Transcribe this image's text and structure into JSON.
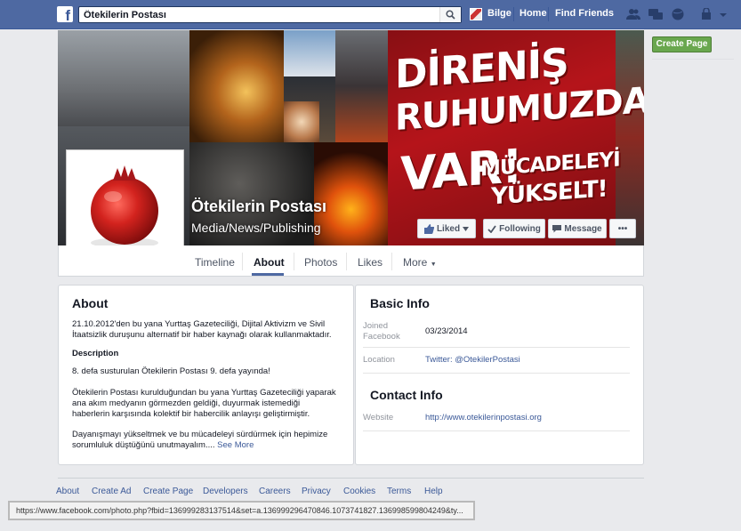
{
  "topbar": {
    "logo": "f",
    "search_value": "Ötekilerin Postası",
    "user_name": "Bilge",
    "home_label": "Home",
    "find_friends_label": "Find Friends",
    "icons": [
      "friend-requests-icon",
      "messages-icon",
      "notifications-icon",
      "privacy-icon",
      "account-menu-icon"
    ]
  },
  "cover": {
    "banner_line1": "DİRENİŞ",
    "banner_line2": "RUHUMUZDA",
    "banner_line3": "VAR!",
    "banner_line4": "MÜCADELEYİ",
    "banner_line5": "YÜKSELT!",
    "page_name": "Ötekilerin Postası",
    "category": "Media/News/Publishing",
    "buttons": {
      "liked": "Liked",
      "following": "Following",
      "message": "Message",
      "more": "•••"
    }
  },
  "tabs": {
    "timeline": "Timeline",
    "about": "About",
    "photos": "Photos",
    "likes": "Likes",
    "more": "More"
  },
  "about": {
    "title": "About",
    "intro": "21.10.2012'den bu yana Yurttaş Gazeteciliği, Dijital Aktivizm ve Sivil İtaatsizlik duruşunu alternatif bir haber kaynağı olarak kullanmaktadır.",
    "description_title": "Description",
    "desc_p1": "8. defa susturulan Ötekilerin Postası 9. defa yayında!",
    "desc_p2": "Ötekilerin Postası kurulduğundan bu yana Yurttaş Gazeteciliği yaparak ana akım medyanın görmezden geldiği, duyurmak istemediği haberlerin karşısında kolektif bir habercilik anlayışı geliştirmiştir.",
    "desc_p3": "Dayanışmayı yükseltmek ve bu mücadeleyi sürdürmek için hepimize sorumluluk düştüğünü unutmayalım....",
    "see_more": "See More"
  },
  "basic_info": {
    "title": "Basic Info",
    "joined_label": "Joined Facebook",
    "joined_value": "03/23/2014",
    "location_label": "Location",
    "location_value": "Twitter: @OtekilerPostasi"
  },
  "contact_info": {
    "title": "Contact Info",
    "website_label": "Website",
    "website_value": "http://www.otekilerinpostasi.org"
  },
  "sidebar": {
    "create_page": "Create Page"
  },
  "footer": {
    "links": [
      "About",
      "Create Ad",
      "Create Page",
      "Developers",
      "Careers",
      "Privacy",
      "Cookies",
      "Terms",
      "Help"
    ]
  },
  "statusbar": {
    "url": "https://www.facebook.com/photo.php?fbid=136999283137514&set=a.136999296470846.1073741827.136998599804249&ty..."
  },
  "colors": {
    "topbar": "#4e69a2",
    "banner_red": "#b5141a",
    "create_page_green": "#69a74e",
    "link_blue": "#3b5998"
  }
}
